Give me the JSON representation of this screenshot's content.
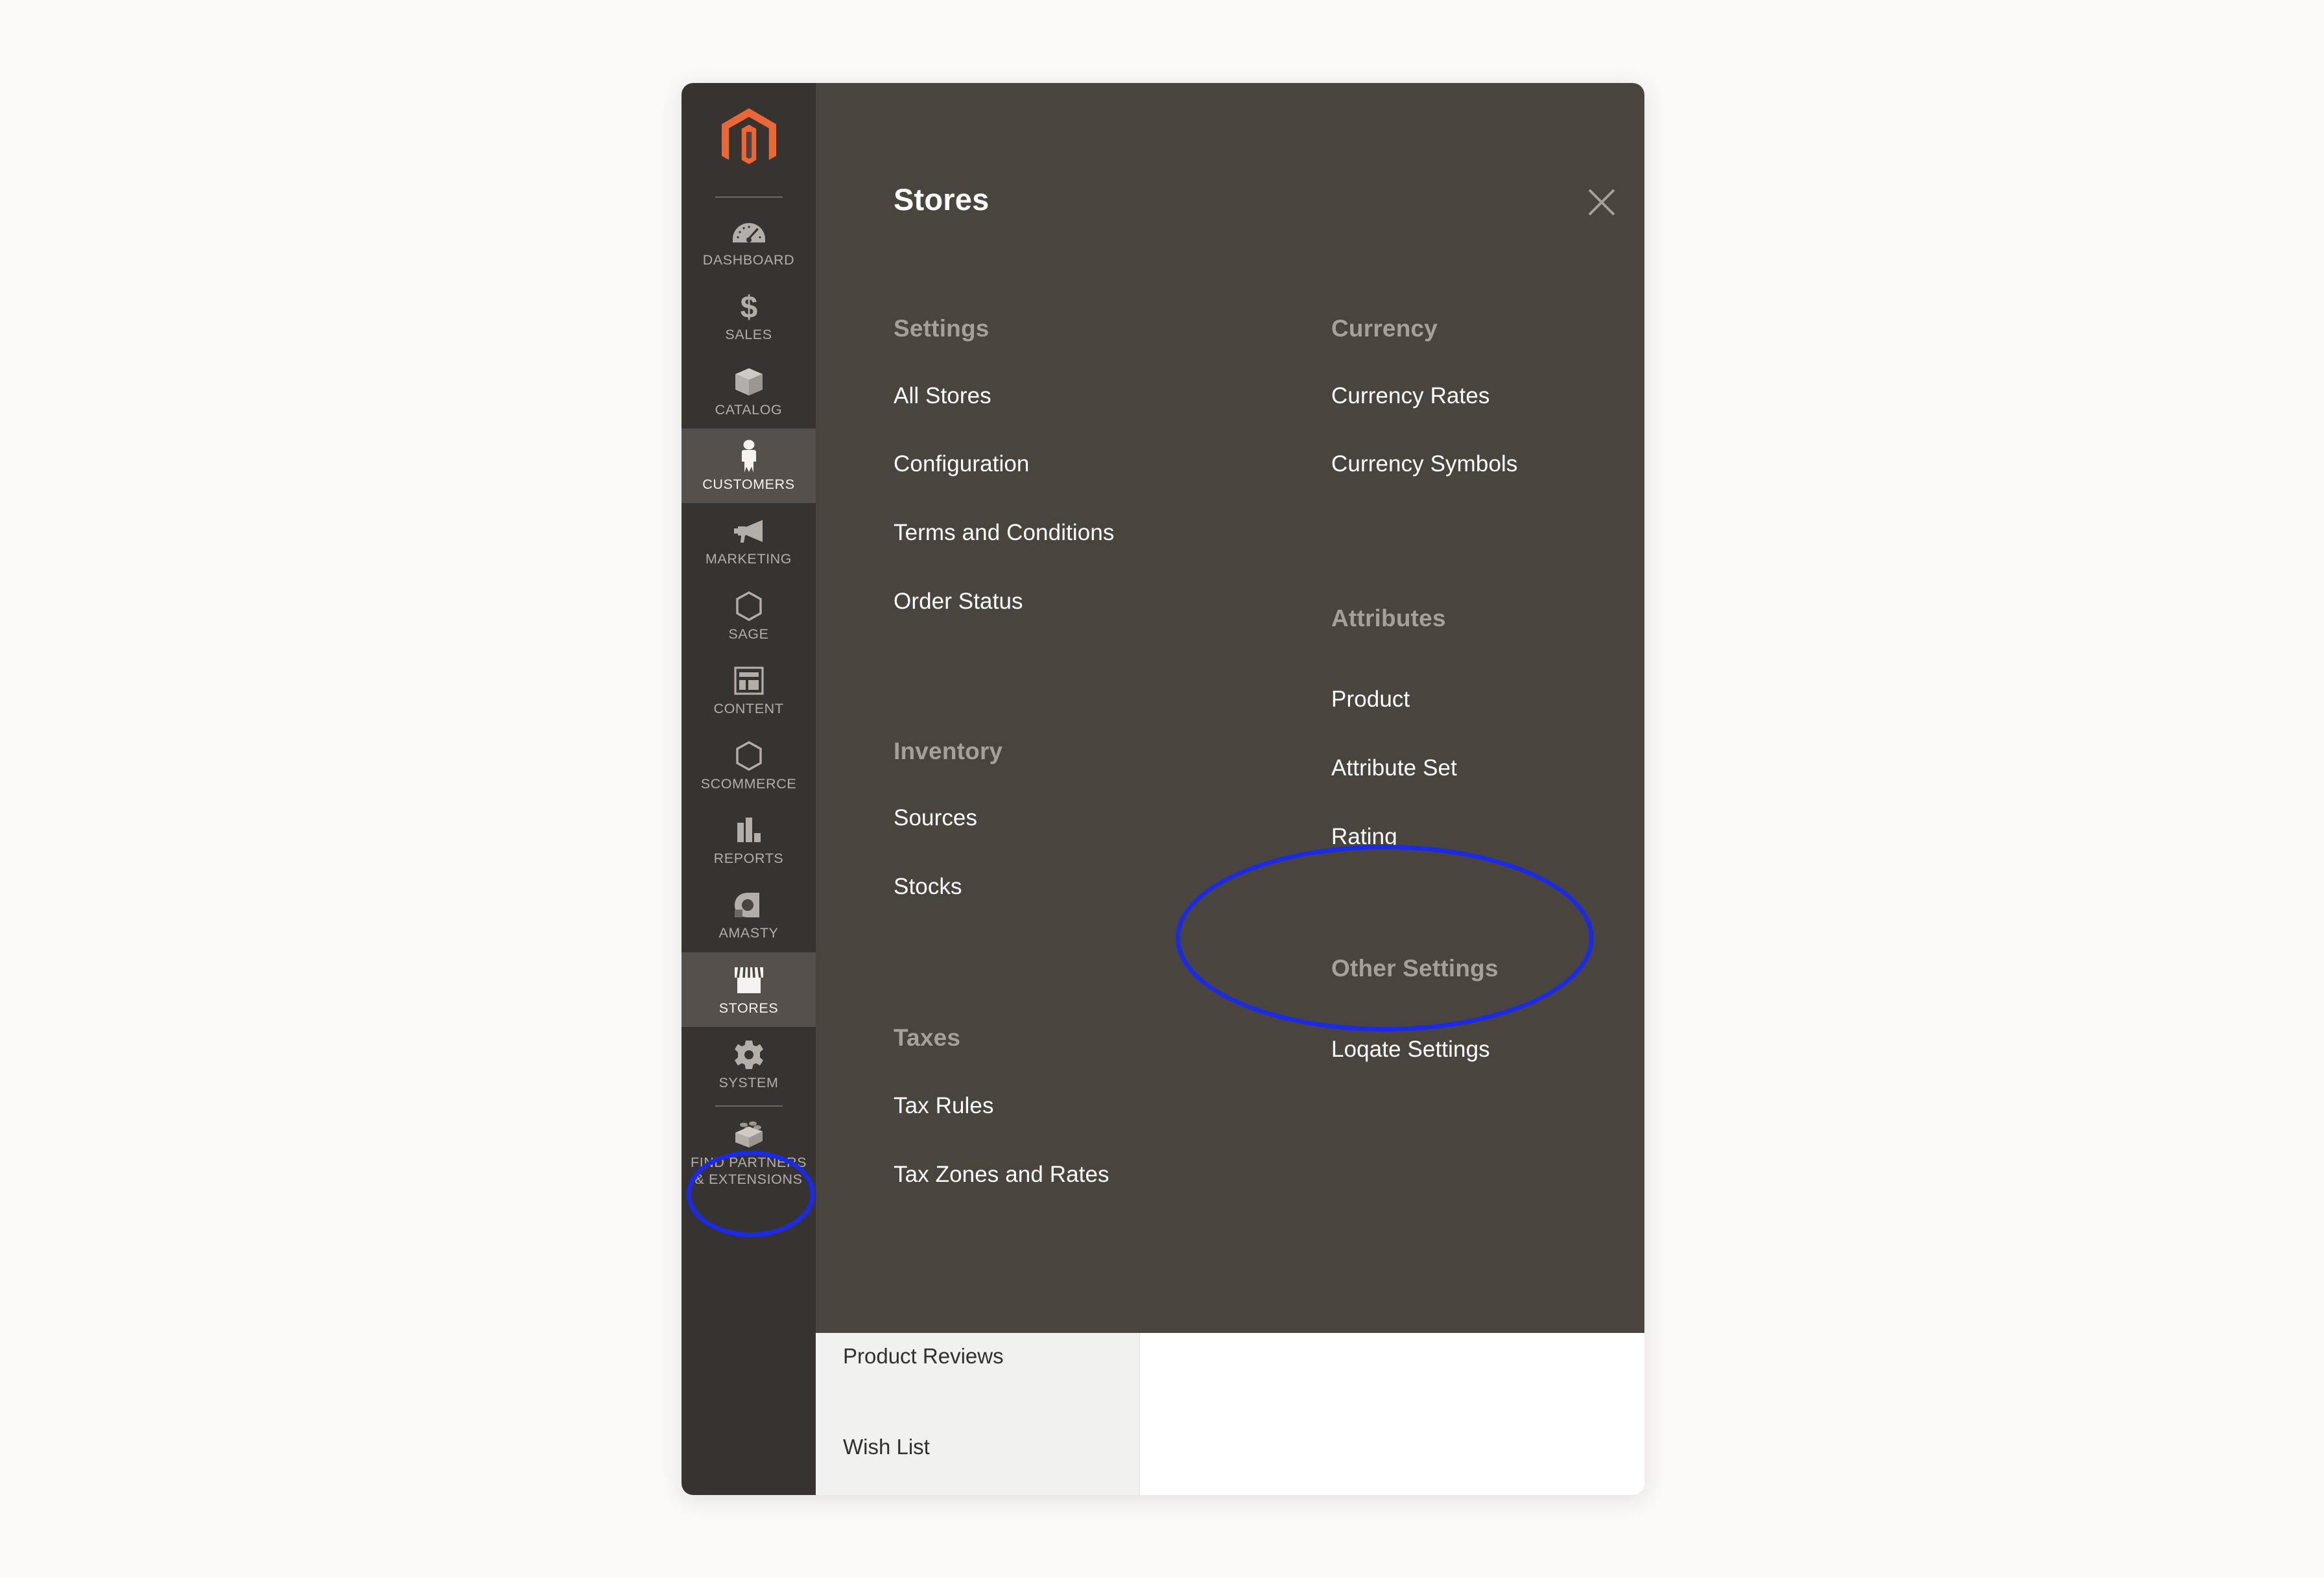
{
  "app": {
    "name": "Magento Admin",
    "logo_icon": "magento-logo-icon",
    "logo_color": "#ec6737"
  },
  "sidebar": {
    "items": [
      {
        "label": "DASHBOARD",
        "icon": "dashboard-gauge-icon",
        "active": false
      },
      {
        "label": "SALES",
        "icon": "dollar-sign-icon",
        "active": false
      },
      {
        "label": "CATALOG",
        "icon": "box-icon",
        "active": false
      },
      {
        "label": "CUSTOMERS",
        "icon": "person-icon",
        "active": true
      },
      {
        "label": "MARKETING",
        "icon": "megaphone-icon",
        "active": false
      },
      {
        "label": "SAGE",
        "icon": "hexagon-icon",
        "active": false
      },
      {
        "label": "CONTENT",
        "icon": "layout-window-icon",
        "active": false
      },
      {
        "label": "SCOMMERCE",
        "icon": "hexagon-icon",
        "active": false
      },
      {
        "label": "REPORTS",
        "icon": "bar-chart-icon",
        "active": false
      },
      {
        "label": "AMASTY",
        "icon": "amasty-letter-a-icon",
        "active": false
      },
      {
        "label": "STORES",
        "icon": "storefront-icon",
        "active": true
      },
      {
        "label": "SYSTEM",
        "icon": "gear-icon",
        "active": false
      },
      {
        "label": "FIND PARTNERS\n& EXTENSIONS",
        "icon": "lego-brick-icon",
        "active": false
      }
    ]
  },
  "flyout": {
    "title": "Stores",
    "close_icon": "close-x-icon",
    "columns": [
      {
        "name": "left",
        "groups": [
          {
            "title": "Settings",
            "items": [
              "All Stores",
              "Configuration",
              "Terms and Conditions",
              "Order Status"
            ]
          },
          {
            "title": "Inventory",
            "items": [
              "Sources",
              "Stocks"
            ]
          },
          {
            "title": "Taxes",
            "items": [
              "Tax Rules",
              "Tax Zones and Rates"
            ]
          }
        ]
      },
      {
        "name": "right",
        "groups": [
          {
            "title": "Currency",
            "items": [
              "Currency Rates",
              "Currency Symbols"
            ]
          },
          {
            "title": "Attributes",
            "items": [
              "Product",
              "Attribute Set",
              "Rating"
            ]
          },
          {
            "title": "Other Settings",
            "items": [
              "Loqate Settings"
            ]
          }
        ]
      }
    ]
  },
  "background_page": {
    "rows": [
      "Product Reviews",
      "Wish List"
    ]
  },
  "annotations": [
    {
      "name": "loqate-settings-highlight",
      "shape": "ellipse",
      "color": "#1a2ae8",
      "targets": [
        "Other Settings",
        "Loqate Settings"
      ]
    },
    {
      "name": "stores-nav-highlight",
      "shape": "ellipse",
      "color": "#1a2ae8",
      "targets": [
        "STORES"
      ]
    }
  ]
}
